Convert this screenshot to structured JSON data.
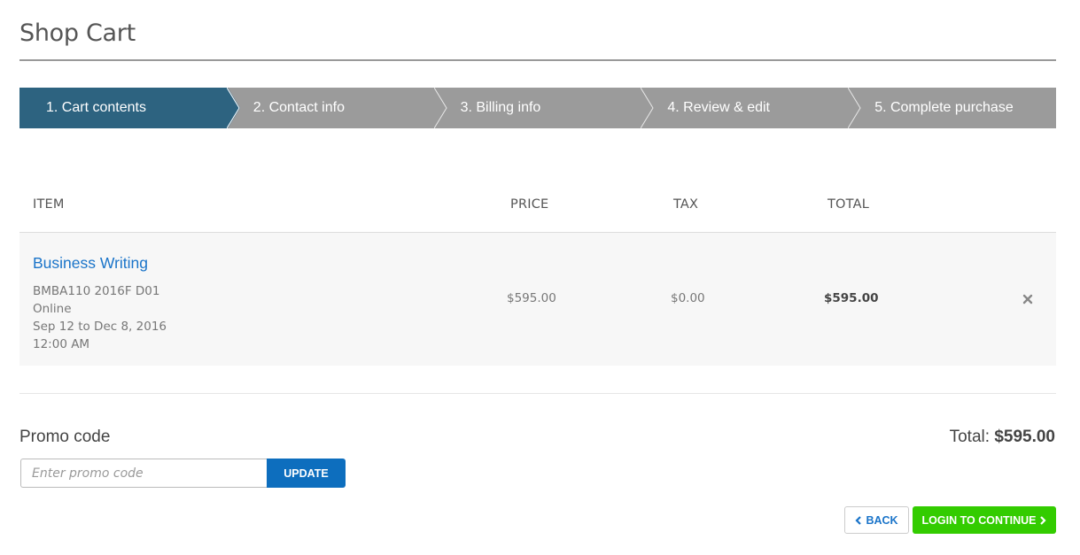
{
  "page": {
    "title": "Shop Cart"
  },
  "stepper": {
    "steps": [
      {
        "label": "1. Cart contents",
        "active": true
      },
      {
        "label": "2. Contact info",
        "active": false
      },
      {
        "label": "3. Billing info",
        "active": false
      },
      {
        "label": "4. Review & edit",
        "active": false
      },
      {
        "label": "5. Complete purchase",
        "active": false
      }
    ],
    "active_color": "#2d6380",
    "inactive_color": "#9b9b9b"
  },
  "table": {
    "headers": {
      "item": "ITEM",
      "price": "PRICE",
      "tax": "TAX",
      "total": "TOTAL"
    },
    "rows": [
      {
        "name": "Business Writing",
        "code": "BMBA110 2016F D01",
        "delivery": "Online",
        "dates": "Sep 12 to Dec 8, 2016",
        "time": "12:00 AM",
        "price": "$595.00",
        "tax": "$0.00",
        "total": "$595.00",
        "remove_icon": "close-icon"
      }
    ]
  },
  "promo": {
    "label": "Promo code",
    "value": "",
    "placeholder": "Enter promo code",
    "button_label": "UPDATE"
  },
  "summary": {
    "total_label": "Total:",
    "total_value": "$595.00"
  },
  "actions": {
    "back_label": "BACK",
    "back_icon": "chevron-left-icon",
    "continue_label": "LOGIN TO CONTINUE",
    "continue_icon": "chevron-right-icon",
    "continue_color": "#33cc00",
    "link_color": "#1a74c9"
  }
}
